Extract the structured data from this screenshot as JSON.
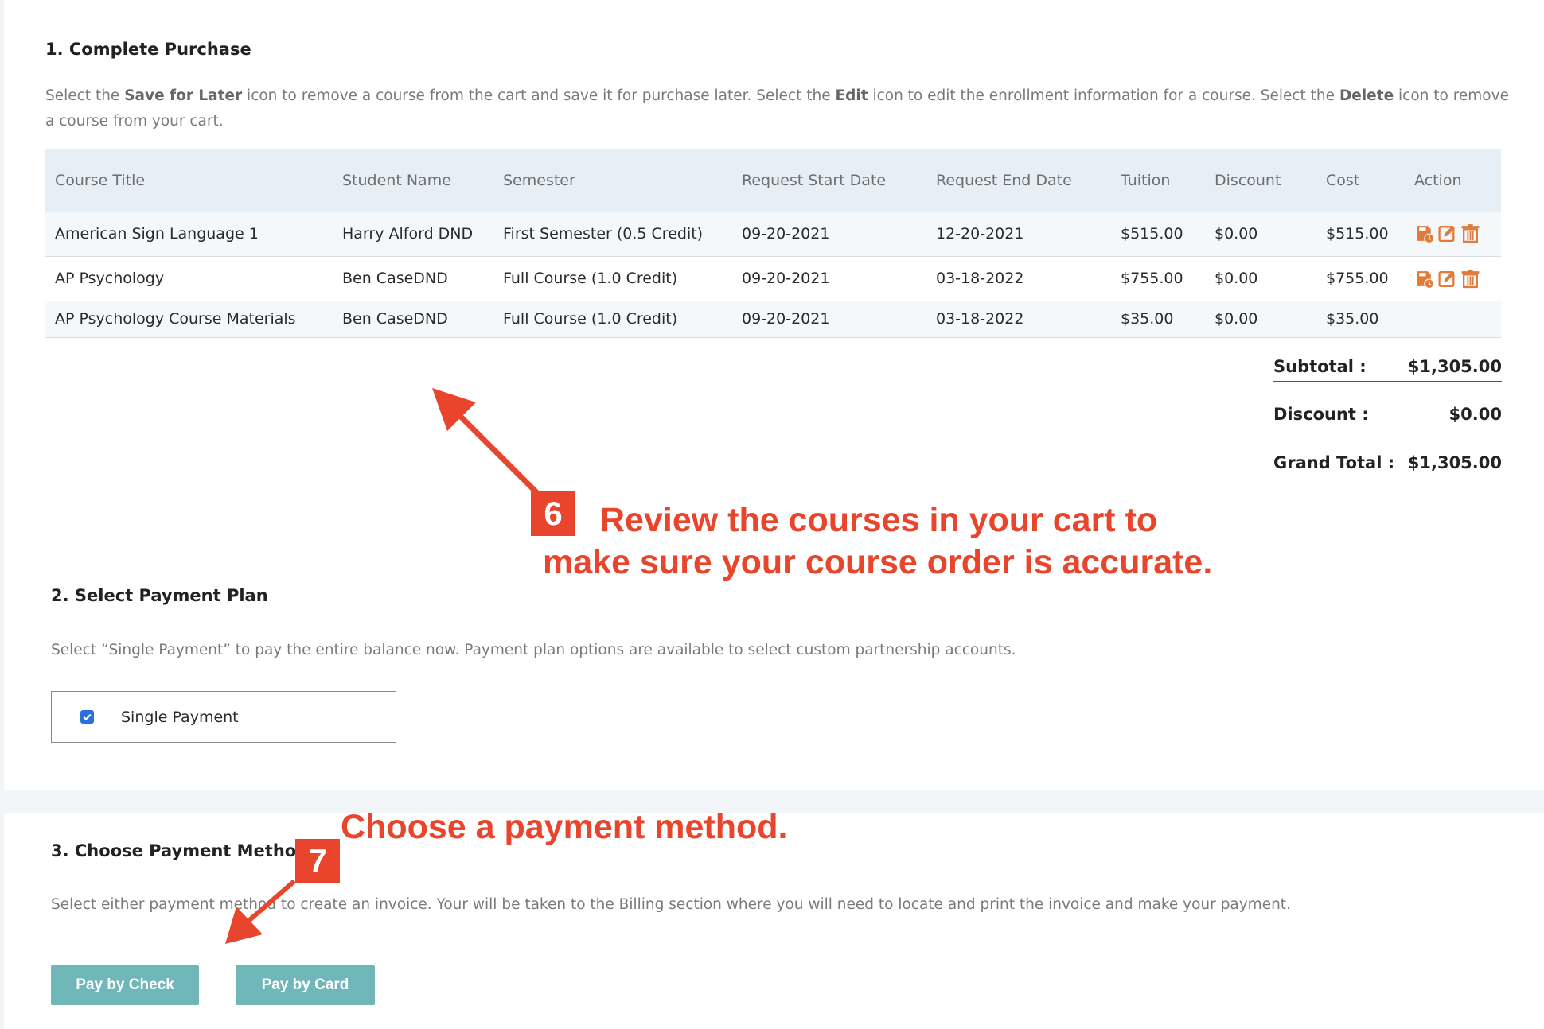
{
  "section1": {
    "title": "1. Complete Purchase",
    "desc_parts": [
      "Select the ",
      "Save for Later",
      " icon to remove a course from the cart and save it for purchase later. Select the ",
      "Edit",
      " icon to edit the enrollment information for a course. Select the ",
      "Delete",
      " icon to remove a course from your cart."
    ]
  },
  "table": {
    "headers": [
      "Course Title",
      "Student Name",
      "Semester",
      "Request Start Date",
      "Request End Date",
      "Tuition",
      "Discount",
      "Cost",
      "Action"
    ],
    "rows": [
      [
        "American Sign Language 1",
        "Harry Alford DND",
        "First Semester (0.5 Credit)",
        "09-20-2021",
        "12-20-2021",
        "$515.00",
        "$0.00",
        "$515.00"
      ],
      [
        "AP Psychology",
        "Ben CaseDND",
        "Full Course (1.0 Credit)",
        "09-20-2021",
        "03-18-2022",
        "$755.00",
        "$0.00",
        "$755.00"
      ],
      [
        "AP Psychology Course Materials",
        "Ben CaseDND",
        "Full Course (1.0 Credit)",
        "09-20-2021",
        "03-18-2022",
        "$35.00",
        "$0.00",
        "$35.00"
      ]
    ],
    "action_icons": [
      "save-for-later-icon",
      "edit-icon",
      "delete-icon"
    ],
    "icon_color": "#e07b39"
  },
  "totals": {
    "subtotal_label": "Subtotal :",
    "subtotal": "$1,305.00",
    "discount_label": "Discount :",
    "discount": "$0.00",
    "grand_label": "Grand Total :",
    "grand": "$1,305.00"
  },
  "section2": {
    "title": "2. Select Payment Plan",
    "desc": "Select “Single Payment” to pay the entire balance now. Payment plan options are available to select custom partnership accounts.",
    "option_label": "Single Payment",
    "checked": true
  },
  "section3": {
    "title": "3. Choose Payment Method",
    "desc": "Select either payment method to create an invoice. Your will be taken to the Billing section where you will need to locate and print the invoice and make your payment.",
    "pay_check": "Pay by Check",
    "pay_card": "Pay by Card",
    "button_color": "#6fb7b9"
  },
  "annotations": {
    "step6_badge": "6",
    "step6_line1": "Review the courses in your cart to",
    "step6_line2": "make sure your course order is accurate.",
    "step7_badge": "7",
    "step7_text": "Choose a payment method.",
    "color": "#e8452c"
  }
}
